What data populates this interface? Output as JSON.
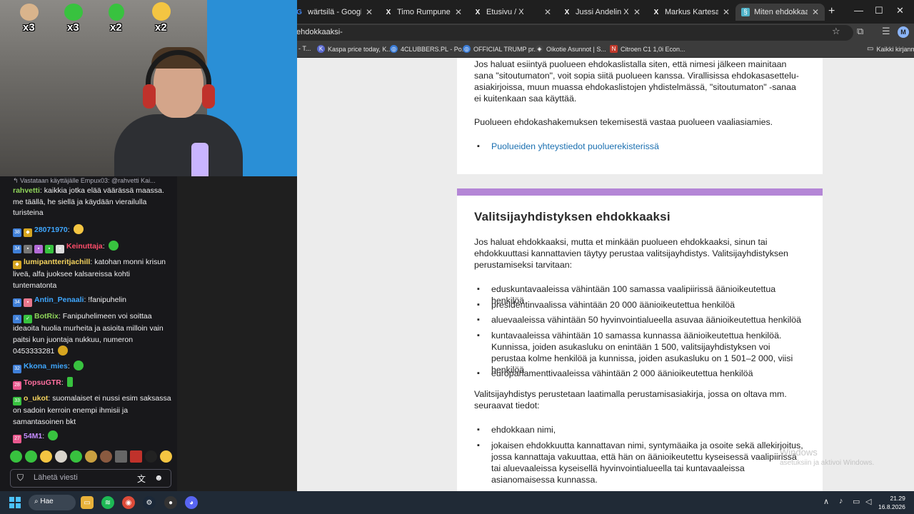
{
  "browser": {
    "tabs": [
      {
        "label": "wärtsilä - Google-haku",
        "favicon": "google-icon",
        "active": false
      },
      {
        "label": "Timo Rumpunen X:ssä",
        "favicon": "x-icon",
        "active": false
      },
      {
        "label": "Etusivu / X",
        "favicon": "x-icon",
        "active": false
      },
      {
        "label": "Jussi Andelin X:ssä: \"E",
        "favicon": "x-icon",
        "active": false
      },
      {
        "label": "Markus Kartesalo re X",
        "favicon": "x-icon",
        "active": false
      },
      {
        "label": "Miten ehdokkaaksi? -",
        "favicon": "site-icon",
        "active": true
      }
    ],
    "new_tab": "+",
    "controls": {
      "minimize": "—",
      "maximize": "☐",
      "close": "✕"
    },
    "url": "ehdokkaaksi-",
    "profile_initial": "M",
    "bookmarks": [
      {
        "label": "- T...",
        "color": "#888888"
      },
      {
        "label": "Kaspa price today, K...",
        "color": "#5b6ad0"
      },
      {
        "label": "4CLUBBERS.PL - Po...",
        "color": "#3a7bd5"
      },
      {
        "label": "OFFICIAL TRUMP pr...",
        "color": "#3a7bd5"
      },
      {
        "label": "Oikotie Asunnot | S...",
        "color": "#444444"
      },
      {
        "label": "Citroen C1 1,0i Econ...",
        "color": "#c0392b"
      }
    ],
    "bookmarks_folder": "Kaikki kirjanm"
  },
  "article": {
    "section1": {
      "para1": "Jos haluat esiintyä puolueen ehdokaslistalla siten, että nimesi jälkeen mainitaan sana \"sitoutumaton\", voit sopia siitä puolueen kanssa. Virallisissa ehdokasasettelu­asiakirjoissa, muun muassa ehdokaslistojen yhdistelmässä, \"sitoutumaton\" -sanaa ei kuitenkaan saa käyttää.",
      "para2": "Puolueen ehdokashakemuksen tekemisestä vastaa puolueen vaaliasiamies.",
      "link": "Puolueiden yhteystiedot puoluerekisterissä"
    },
    "section2": {
      "heading": "Valitsijayhdistyksen ehdokkaaksi",
      "intro": "Jos haluat ehdokkaaksi, mutta et minkään puolueen ehdokkaaksi, sinun tai ehdokkuuttasi kannattavien täytyy perustaa valitsijayhdistys. Valitsijayhdistyksen perustamiseksi tarvitaan:",
      "requirements": [
        "eduskuntavaaleissa vähintään 100 samassa vaalipiirissä äänioikeutettua henkilöä",
        "presidentinvaalissa vähintään 20 000 äänioikeutettua henkilöä",
        "aluevaaleissa vähintään 50 hyvinvointialueella asuvaa äänioikeutettua henkilöä",
        "kuntavaaleissa vähintään 10 samassa kunnassa äänioikeutettua henkilöä. Kunnissa, joiden asukasluku on enintään 1 500, valitsijayhdistyksen voi perustaa kolme henkilöä ja kunnissa, joiden asukasluku on 1 501–2 000, viisi henkilöä",
        "europarlamenttivaaleissa vähintään 2 000 äänioikeutettua henkilöä"
      ],
      "para_docs": "Valitsijayhdistys perustetaan laatimalla perustamisasiakirja, jossa on oltava mm. seuraavat tiedot:",
      "doc_items": [
        "ehdokkaan nimi,",
        "jokaisen ehdokkuutta kannattavan nimi, syntymäaika ja osoite sekä allekirjoitus, jossa kannattaja vakuuttaa, että hän on äänioikeutettu kyseisessä vaalipiirissä tai aluevaaleissa kyseisellä hyvinvointialueella tai kuntavaaleissa asianomaisessa kunnassa."
      ]
    }
  },
  "stream": {
    "multipliers": [
      "x3",
      "x3",
      "x2",
      "x2"
    ],
    "reply_to": "Vastataan käyttäjälle Empux03: @rahvetti Kai...",
    "messages": [
      {
        "user": "rahvetti",
        "color": "#8fd45a",
        "text": "kaikkia jotka elää väärässä maassa. me täällä, he siellä ja käydään vierailulla turisteina"
      },
      {
        "user": "28071970",
        "color": "#3fa7ff",
        "text": ""
      },
      {
        "user": "Keinuttaja",
        "color": "#ff4d6a",
        "text": ""
      },
      {
        "user": "lumipantteritjachill",
        "color": "#f4d35e",
        "text": "katohan monni krisun liveä, alfa juoksee kalsareissa kohti tuntematonta"
      },
      {
        "user": "Antin_Penaali",
        "color": "#3fa7ff",
        "text": "!fanipuhelin"
      },
      {
        "user": "BotRix",
        "color": "#8fd45a",
        "text": "Fanipuhelimeen voi soittaa ideaoita huolia murheita ja asioita milloin vain paitsi kun juontaja nukkuu, numeron 0453333281"
      },
      {
        "user": "Kkona_mies",
        "color": "#3fa7ff",
        "text": ""
      },
      {
        "user": "TopsuGTR",
        "color": "#ff6f9f",
        "text": ""
      },
      {
        "user": "o_ukot",
        "color": "#f4d35e",
        "text": "suomalaiset ei nussi esim saksassa on sadoin kerroin enempi ihmisii ja samantasoinen bkt"
      },
      {
        "user": "54M1",
        "color": "#c58cff",
        "text": ""
      }
    ],
    "badges": [
      "38",
      "34",
      "34",
      "32",
      "28",
      "33",
      "27"
    ],
    "chat_placeholder": "Lähetä viesti"
  },
  "watermark": {
    "line1": "Windows",
    "line2": "asetuksiin ja aktivoi Windows."
  },
  "taskbar": {
    "search_label": "Hae",
    "time": "21.29",
    "date": "16.8.2026"
  }
}
